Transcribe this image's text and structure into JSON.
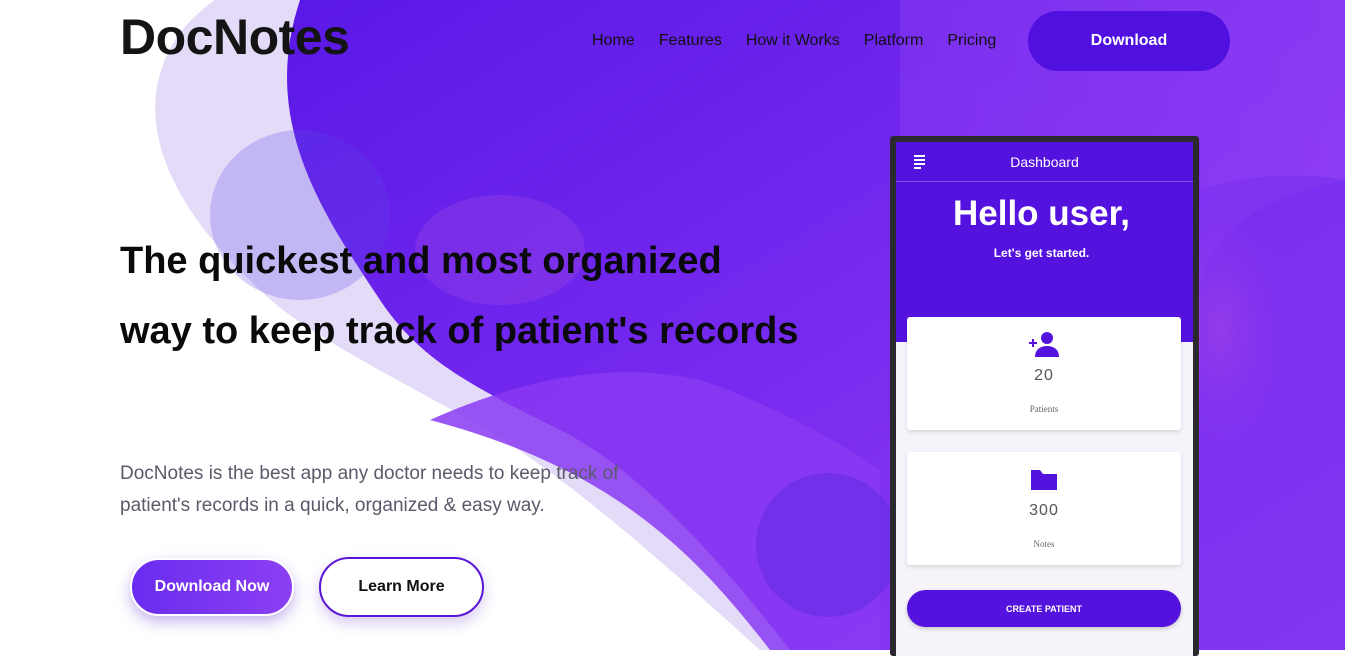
{
  "header": {
    "brand": "DocNotes",
    "nav": [
      "Home",
      "Features",
      "How it Works",
      "Platform",
      "Pricing"
    ],
    "download_label": "Download"
  },
  "hero": {
    "title": "The quickest and most organized way to keep track of patient's records",
    "subtitle": "DocNotes is the best app any doctor needs to keep track of patient's records in a quick, organized & easy way.",
    "primary_cta": "Download Now",
    "secondary_cta": "Learn More"
  },
  "phone": {
    "appbar_title": "Dashboard",
    "greeting": "Hello user,",
    "greeting_sub": "Let's get started.",
    "stats": [
      {
        "icon": "add-person-icon",
        "value": "20",
        "label": "Patients"
      },
      {
        "icon": "folder-icon",
        "value": "300",
        "label": "Notes"
      }
    ],
    "create_button": "CREATE PATIENT"
  },
  "colors": {
    "accent": "#5010e0",
    "purple_light": "#8c3ff2",
    "lavender": "#e2d7f7",
    "text_dark": "#0a0a0a",
    "text_muted": "#5a5a6a"
  }
}
